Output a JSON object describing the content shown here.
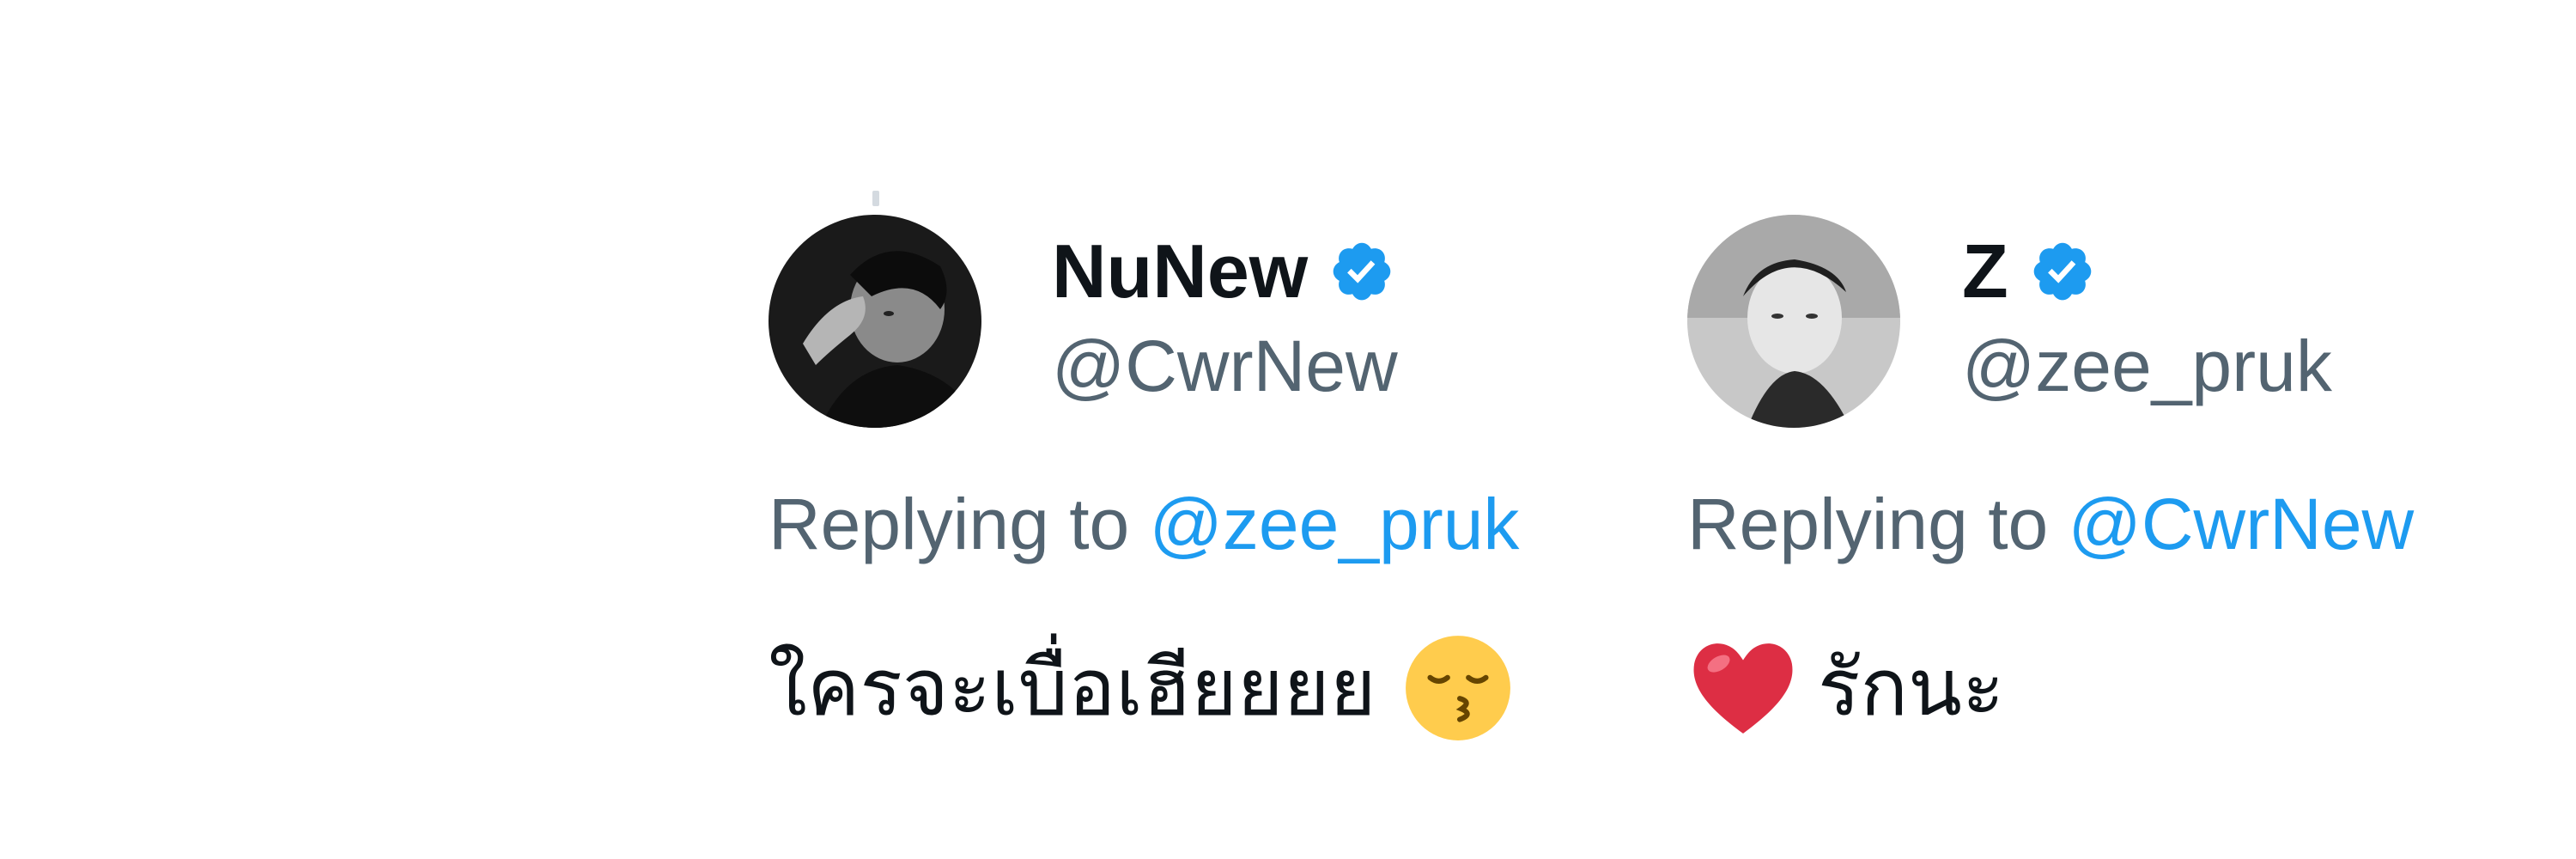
{
  "replies": [
    {
      "display_name": "NuNew",
      "verified": true,
      "handle": "@CwrNew",
      "replying_prefix": "Replying to",
      "replying_to": "@zee_pruk",
      "text": "ใครจะเบื่อเฮียยยย",
      "emoji": "kissing-closed-eyes-icon"
    },
    {
      "display_name": "Z",
      "verified": true,
      "handle": "@zee_pruk",
      "replying_prefix": "Replying to",
      "replying_to": "@CwrNew",
      "text": "รักนะ",
      "emoji": "red-heart-icon"
    }
  ],
  "colors": {
    "text_primary": "#0f1419",
    "text_secondary": "#536471",
    "link": "#1d9bf0",
    "verified_badge": "#1d9bf0"
  }
}
